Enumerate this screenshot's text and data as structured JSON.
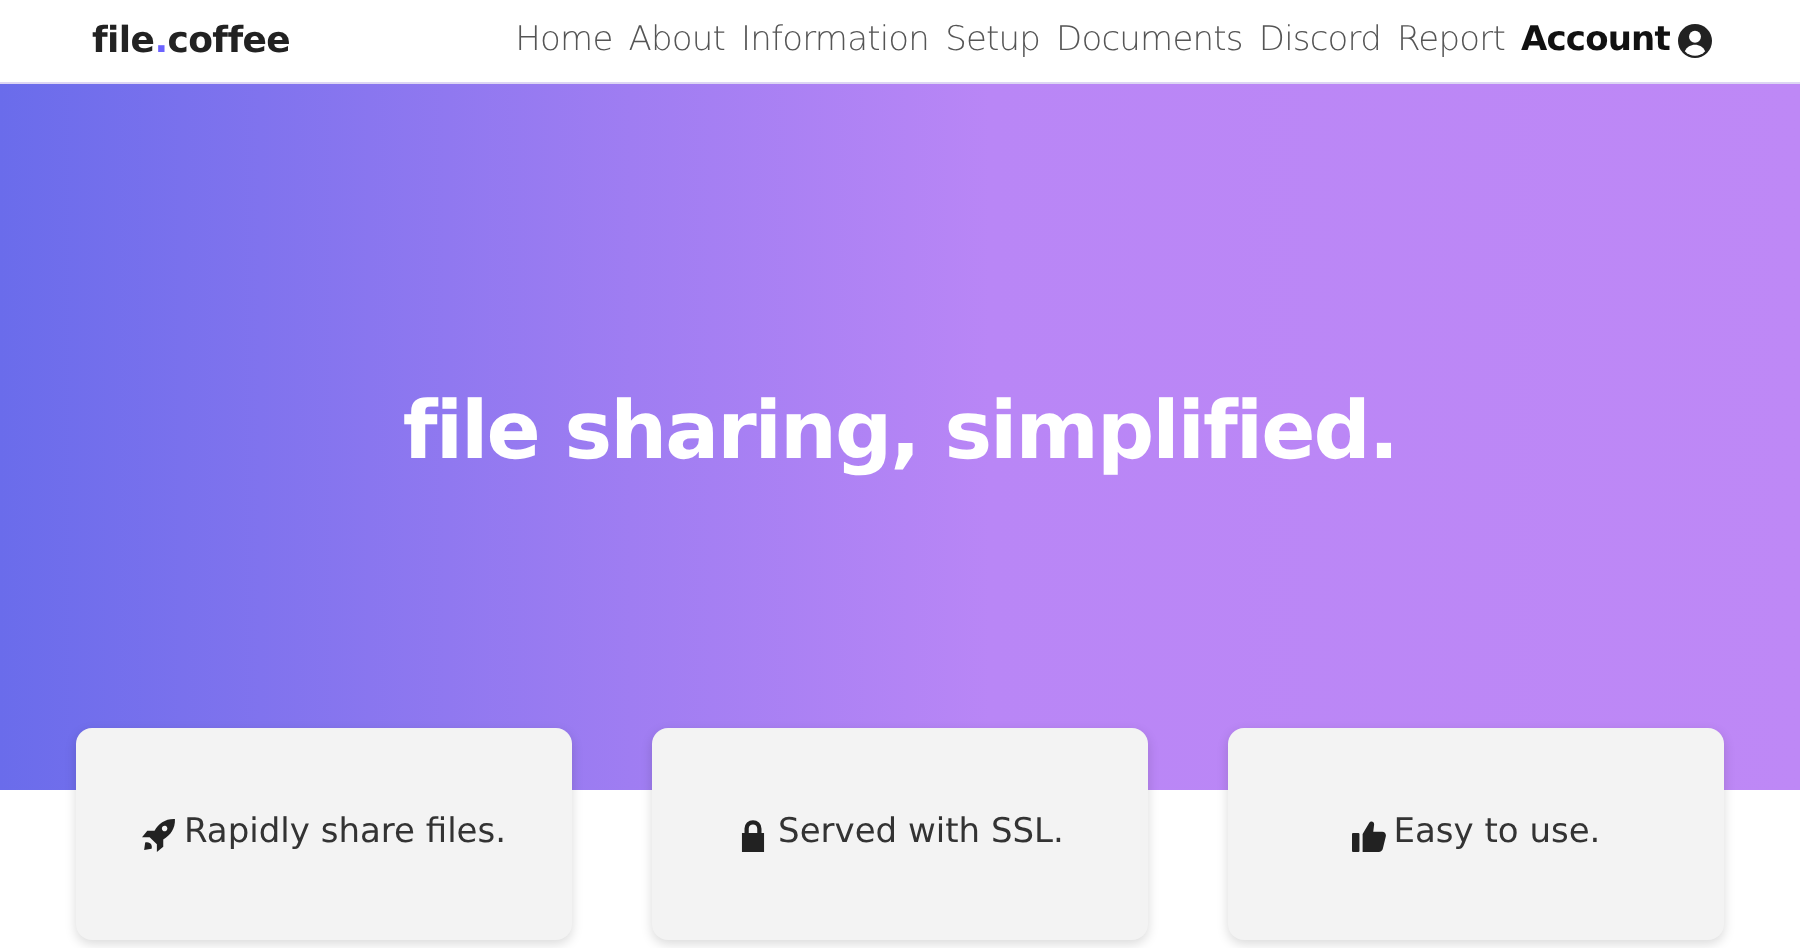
{
  "brand": [
    {
      "text": "file",
      "accent": false
    },
    {
      "text": ".",
      "accent": true
    },
    {
      "text": "coffee",
      "accent": false
    }
  ],
  "nav": [
    {
      "label": "Home",
      "kind": "link"
    },
    {
      "label": "About",
      "kind": "link"
    },
    {
      "label": "Information",
      "kind": "link"
    },
    {
      "label": "Setup",
      "kind": "link"
    },
    {
      "label": "Documents",
      "kind": "link"
    },
    {
      "label": "Discord",
      "kind": "link"
    },
    {
      "label": "Report",
      "kind": "link"
    },
    {
      "label": "Account",
      "kind": "account"
    }
  ],
  "hero": {
    "title": "file sharing, simplified."
  },
  "features": [
    {
      "text": "Rapidly share files."
    },
    {
      "text": "Served with SSL."
    },
    {
      "text": "Easy to use."
    }
  ]
}
